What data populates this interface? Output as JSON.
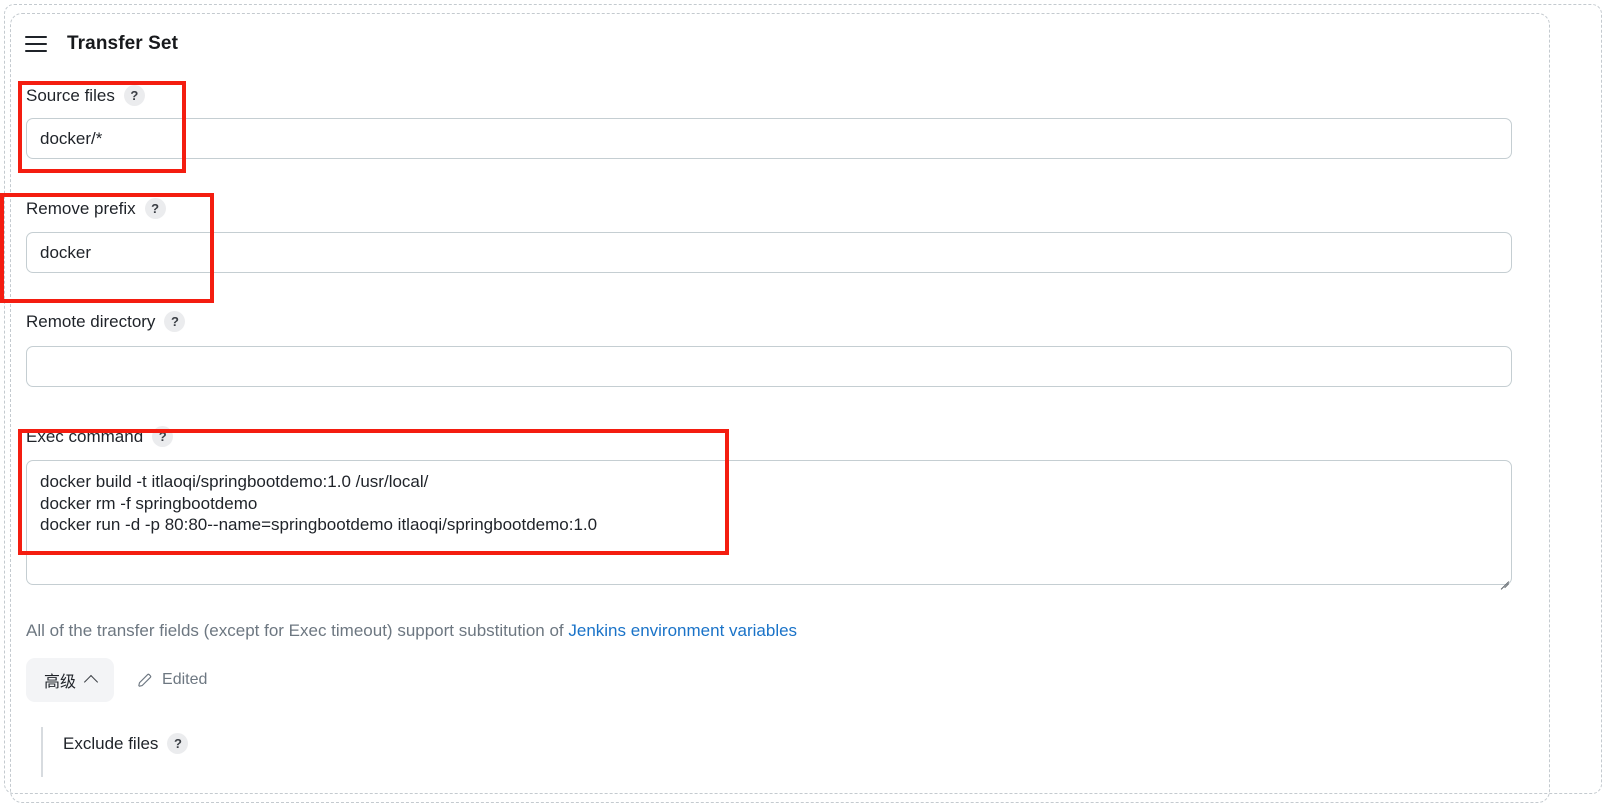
{
  "panel": {
    "title": "Transfer Set",
    "drag_handle_icon": "hamburger-drag-icon"
  },
  "fields": {
    "source_files": {
      "label": "Source files",
      "help_icon": "?",
      "value": "docker/*",
      "placeholder": ""
    },
    "remove_prefix": {
      "label": "Remove prefix",
      "help_icon": "?",
      "value": "docker",
      "placeholder": ""
    },
    "remote_directory": {
      "label": "Remote directory",
      "help_icon": "?",
      "value": "",
      "placeholder": ""
    },
    "exec_command": {
      "label": "Exec command",
      "help_icon": "?",
      "value": "docker build -t itlaoqi/springbootdemo:1.0 /usr/local/\ndocker rm -f springbootdemo\ndocker run -d -p 80:80--name=springbootdemo itlaoqi/springbootdemo:1.0",
      "placeholder": ""
    },
    "exclude_files": {
      "label": "Exclude files",
      "help_icon": "?"
    }
  },
  "helper": {
    "prefix_text": "All of the transfer fields (except for Exec timeout) support substitution of ",
    "link_text": "Jenkins environment variables"
  },
  "advanced": {
    "label": "高级",
    "chevron_icon": "chevron-up-icon",
    "edited_label": "Edited",
    "edited_icon": "pencil-icon"
  },
  "colors": {
    "annotation_red": "#f41d10",
    "link_blue": "#1a73c8",
    "input_border": "#c5ced2",
    "dashed_border": "#c4cacf",
    "muted_text": "#6d7781"
  }
}
